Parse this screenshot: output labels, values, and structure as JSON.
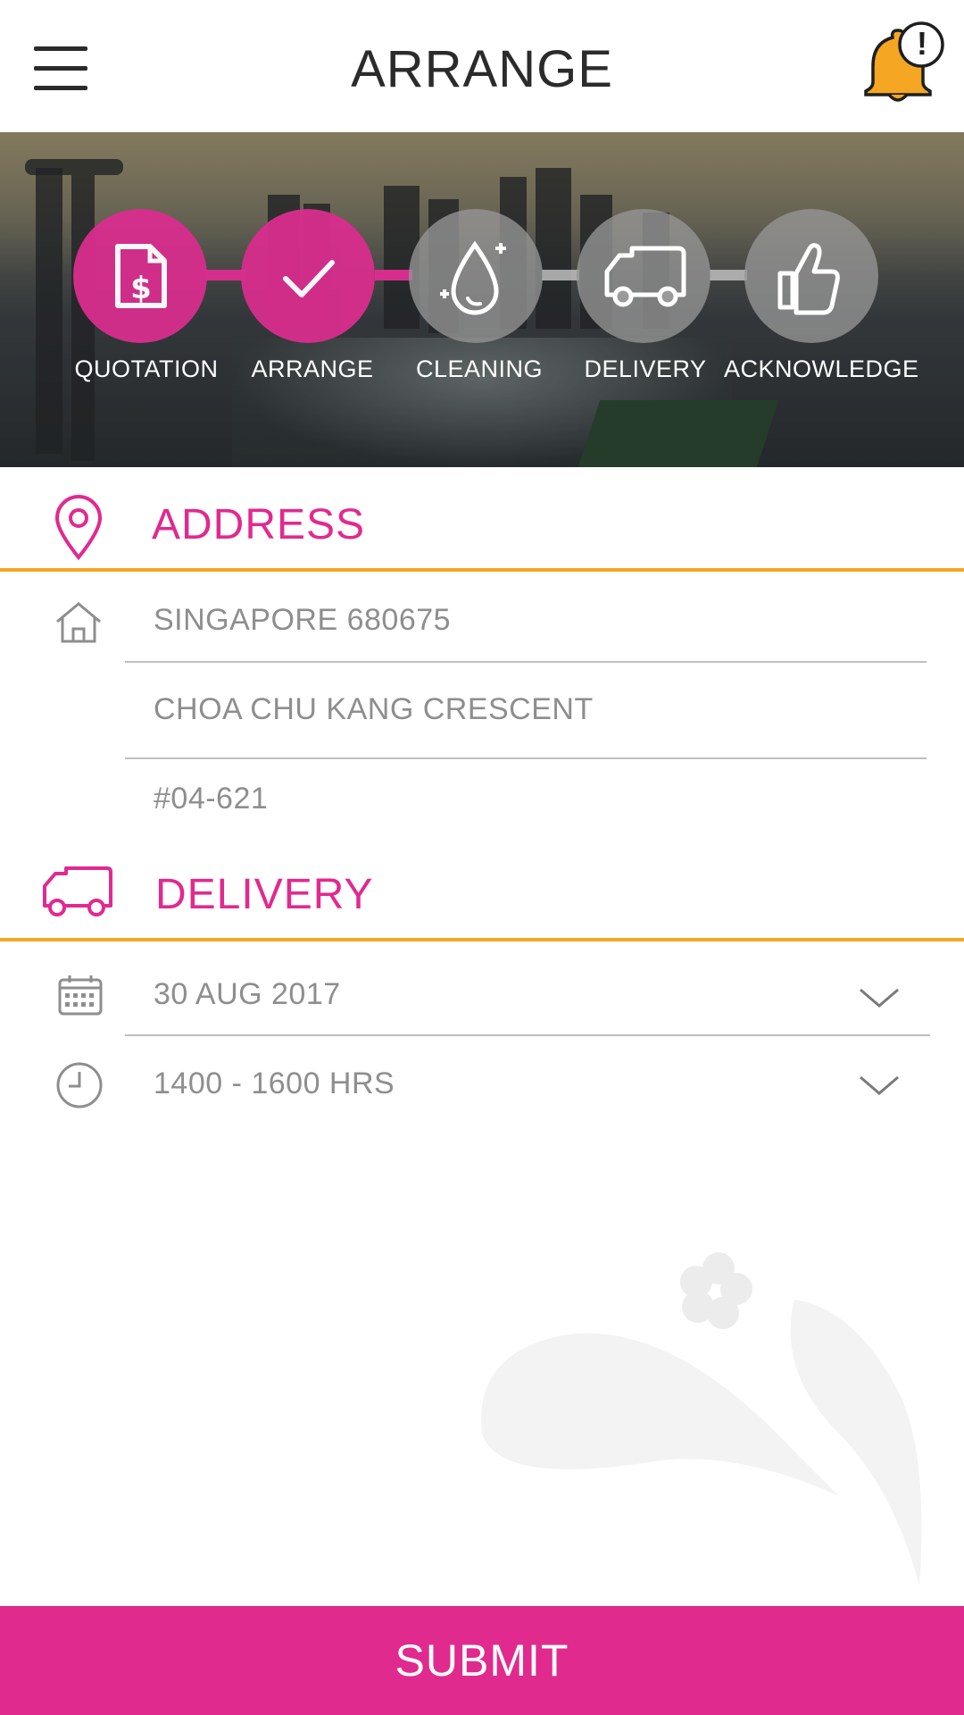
{
  "header": {
    "title": "ARRANGE",
    "notification_badge": "!"
  },
  "progress": {
    "steps": [
      {
        "label": "QUOTATION",
        "icon": "quotation-dollar-icon",
        "state": "active"
      },
      {
        "label": "ARRANGE",
        "icon": "checkmark-icon",
        "state": "active"
      },
      {
        "label": "CLEANING",
        "icon": "water-drop-icon",
        "state": "inactive"
      },
      {
        "label": "DELIVERY",
        "icon": "truck-icon",
        "state": "inactive"
      },
      {
        "label": "ACKNOWLEDGE",
        "icon": "thumbs-up-icon",
        "state": "inactive"
      }
    ]
  },
  "address": {
    "heading": "ADDRESS",
    "postal": "SINGAPORE 680675",
    "street": "CHOA CHU KANG CRESCENT",
    "unit": "#04-621"
  },
  "delivery": {
    "heading": "DELIVERY",
    "date": "30 AUG 2017",
    "time": "1400 - 1600 HRS"
  },
  "actions": {
    "submit_label": "SUBMIT"
  },
  "colors": {
    "accent_pink": "#e02a8e",
    "rule_orange": "#f5a623",
    "bell_yellow": "#f5a623",
    "text_gray": "#8e8e8e"
  }
}
